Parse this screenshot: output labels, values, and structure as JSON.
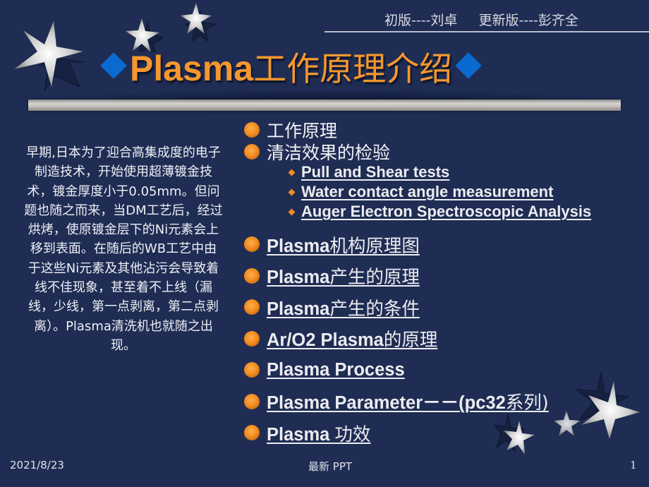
{
  "slide": {
    "credits": {
      "original": "初版----刘卓",
      "updated": "更新版----彭齐全"
    },
    "title": {
      "latin": "Plasma",
      "chinese": "工作原理介绍",
      "decoration": "blue-diamond-icon"
    },
    "side_paragraph": "早期,日本为了迎合高集成度的电子制造技术，开始使用超薄镀金技术，镀金厚度小于0.05mm。但问题也随之而来，当DM工艺后，经过烘烤，使原镀金层下的Ni元素会上移到表面。在随后的WB工艺中由于这些Ni元素及其他沾污会导致着线不佳现象，甚至着不上线（漏线，少线，第一点剥离，第二点剥离）。Plasma清洗机也就随之出现。",
    "outline": {
      "plain_items": [
        {
          "label": "工作原理"
        },
        {
          "label": "清洁效果的检验"
        }
      ],
      "sub_items": [
        {
          "label": "Pull and Shear tests"
        },
        {
          "label": "Water contact angle measurement"
        },
        {
          "label": "Auger Electron Spectroscopic Analysis"
        }
      ],
      "link_items": [
        {
          "latin": "Plasma",
          "cn": "机构原理图"
        },
        {
          "latin": "Plasma",
          "cn": "产生的原理"
        },
        {
          "latin": "Plasma",
          "cn": "产生的条件"
        },
        {
          "latin": "Ar/O2 Plasma",
          "cn": "的原理"
        },
        {
          "latin": "Plasma Process",
          "cn": ""
        },
        {
          "latin": "Plasma Parameter－－(pc32",
          "cn": "系列)"
        },
        {
          "latin": "Plasma ",
          "cn": "功效"
        }
      ]
    },
    "footer": {
      "date": "2021/8/23",
      "center": "最新 PPT",
      "page": "1"
    },
    "colors": {
      "background": "#1f2d54",
      "title": "#f5972e",
      "diamond": "#0a6ad0",
      "bullet": "#f08a1e",
      "text": "#ececf0"
    }
  }
}
